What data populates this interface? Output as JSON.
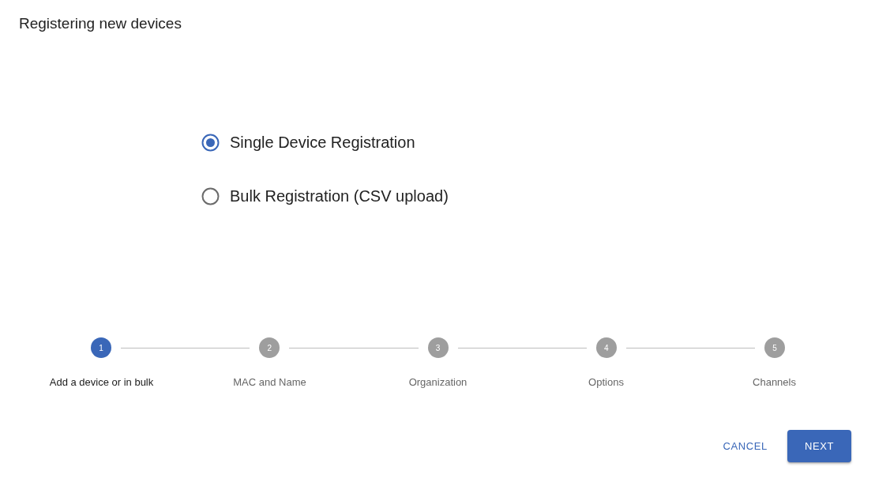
{
  "title": "Registering new devices",
  "registration_options": [
    {
      "label": "Single Device Registration",
      "selected": true
    },
    {
      "label": "Bulk Registration (CSV upload)",
      "selected": false
    }
  ],
  "stepper": {
    "steps": [
      {
        "number": "1",
        "label": "Add a device or in bulk",
        "active": true
      },
      {
        "number": "2",
        "label": "MAC and Name",
        "active": false
      },
      {
        "number": "3",
        "label": "Organization",
        "active": false
      },
      {
        "number": "4",
        "label": "Options",
        "active": false
      },
      {
        "number": "5",
        "label": "Channels",
        "active": false
      }
    ]
  },
  "actions": [
    {
      "label": "CANCEL",
      "kind": "text"
    },
    {
      "label": "NEXT",
      "kind": "contained"
    }
  ]
}
